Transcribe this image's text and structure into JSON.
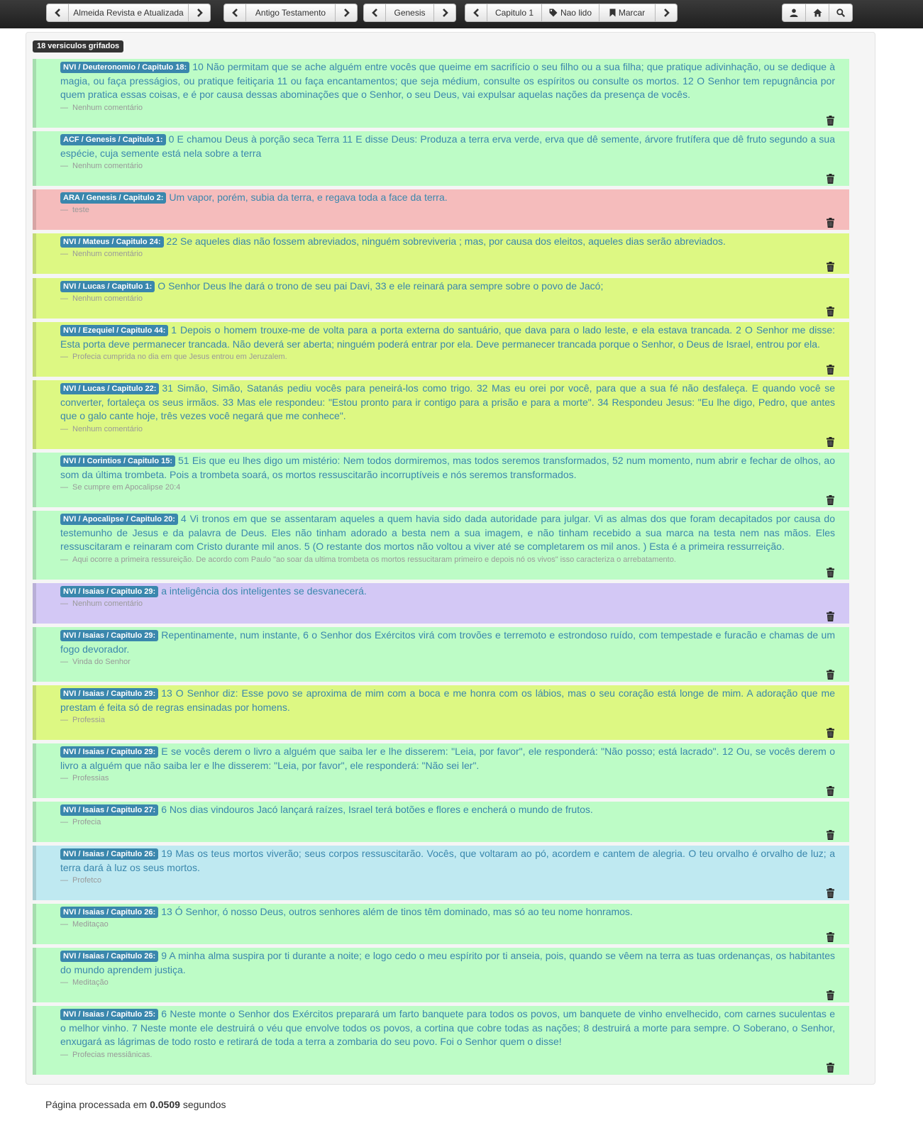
{
  "nav": {
    "version": "Almeida Revista e Atualizada",
    "testament": "Antigo Testamento",
    "book": "Genesis",
    "chapter": "Capitulo 1",
    "unread": "Nao lido",
    "mark": "Marcar"
  },
  "badge": "18 versiculos grifados",
  "colors": {
    "green": "#bdfcc6",
    "red": "#f5bcbc",
    "yellow": "#ddf883",
    "purple": "#d3c8f5",
    "blue": "#bfe9f1",
    "reference_badge": "#3a87ad",
    "verse_text": "#3a87ad"
  },
  "entries": [
    {
      "color": "green",
      "ref": "NVI / Deuteronomio / Capitulo 18:",
      "text": "10 Não permitam que se ache alguém entre vocês que queime em sacrifício o seu filho ou a sua filha; que pratique adivinhação, ou se dedique à magia, ou faça presságios, ou pratique feitiçaria 11 ou faça encantamentos; que seja médium, consulte os espíritos ou consulte os mortos. 12 O Senhor tem repugnância por quem pratica essas coisas, e é por causa dessas abominações que o Senhor, o seu Deus, vai expulsar aquelas nações da presença de vocês.",
      "comment": "Nenhum comentário"
    },
    {
      "color": "green",
      "ref": "ACF / Genesis / Capitulo 1:",
      "text": "0 E chamou Deus à porção seca Terra 11 E disse Deus: Produza a terra erva verde, erva que dê semente, árvore frutífera que dê fruto segundo a sua espécie, cuja semente está nela sobre a terra",
      "comment": "Nenhum comentário"
    },
    {
      "color": "red",
      "ref": "ARA / Genesis / Capitulo 2:",
      "text": "Um vapor, porém, subia da terra, e regava toda a face da terra.",
      "comment": "teste"
    },
    {
      "color": "yellow",
      "ref": "NVI / Mateus / Capitulo 24:",
      "text": "22 Se aqueles dias não fossem abreviados, ninguém sobreviveria ; mas, por causa dos eleitos, aqueles dias serão abreviados.",
      "comment": "Nenhum comentário"
    },
    {
      "color": "yellow",
      "ref": "NVI / Lucas / Capitulo 1:",
      "text": "O Senhor Deus lhe dará o trono de seu pai Davi, 33 e ele reinará para sempre sobre o povo de Jacó;",
      "comment": "Nenhum comentário"
    },
    {
      "color": "yellow",
      "ref": "NVI / Ezequiel / Capitulo 44:",
      "text": "1 Depois o homem trouxe-me de volta para a porta externa do santuário, que dava para o lado leste, e ela estava trancada. 2 O Senhor me disse: Esta porta deve permanecer trancada. Não deverá ser aberta; ninguém poderá entrar por ela. Deve permanecer trancada porque o Senhor, o Deus de Israel, entrou por ela.",
      "comment": "Profecia cumprida no dia em que Jesus entrou em Jeruzalem."
    },
    {
      "color": "yellow",
      "ref": "NVI / Lucas / Capitulo 22:",
      "text": "31 Simão, Simão, Satanás pediu vocês para peneirá-los como trigo. 32 Mas eu orei por você, para que a sua fé não desfaleça. E quando você se converter, fortaleça os seus irmãos. 33 Mas ele respondeu: \"Estou pronto para ir contigo para a prisão e para a morte\". 34 Respondeu Jesus: \"Eu lhe digo, Pedro, que antes que o galo cante hoje, três vezes você negará que me conhece\".",
      "comment": "Nenhum comentário"
    },
    {
      "color": "green",
      "ref": "NVI / I Corintios / Capitulo 15:",
      "text": "51 Eis que eu lhes digo um mistério: Nem todos dormiremos, mas todos seremos transformados, 52 num momento, num abrir e fechar de olhos, ao som da última trombeta. Pois a trombeta soará, os mortos ressuscitarão incorruptíveis e nós seremos transformados.",
      "comment": "Se cumpre em Apocalipse 20:4"
    },
    {
      "color": "green",
      "ref": "NVI / Apocalipse / Capitulo 20:",
      "text": "4 Vi tronos em que se assentaram aqueles a quem havia sido dada autoridade para julgar. Vi as almas dos que foram decapitados por causa do testemunho de Jesus e da palavra de Deus. Eles não tinham adorado a besta nem a sua imagem, e não tinham recebido a sua marca na testa nem nas mãos. Eles ressuscitaram e reinaram com Cristo durante mil anos. 5 (O restante dos mortos não voltou a viver até se completarem os mil anos. ) Esta é a primeira ressurreição.",
      "comment": "Aqui ocorre a primeira ressureição. De acordo com Paulo \"ao soar da ultima trombeta os mortos ressucitaram primeiro e depois nó os vivos\" isso caracteriza o arrebatamento."
    },
    {
      "color": "purple",
      "ref": "NVI / Isaias / Capitulo 29:",
      "text": "a inteligência dos inteligentes se desvanecerá.",
      "comment": "Nenhum comentário"
    },
    {
      "color": "green",
      "ref": "NVI / Isaias / Capitulo 29:",
      "text": "Repentinamente, num instante, 6 o Senhor dos Exércitos virá com trovões e terremoto e estrondoso ruído, com tempestade e furacão e chamas de um fogo devorador.",
      "comment": "Vinda do Senhor"
    },
    {
      "color": "yellow",
      "ref": "NVI / Isaias / Capitulo 29:",
      "text": "13 O Senhor diz: Esse povo se aproxima de mim com a boca e me honra com os lábios, mas o seu coração está longe de mim. A adoração que me prestam é feita só de regras ensinadas por homens.",
      "comment": "Professia"
    },
    {
      "color": "green",
      "ref": "NVI / Isaias / Capitulo 29:",
      "text": "E se vocês derem o livro a alguém que saiba ler e lhe disserem: \"Leia, por favor\", ele responderá: \"Não posso; está lacrado\". 12 Ou, se vocês derem o livro a alguém que não saiba ler e lhe disserem: \"Leia, por favor\", ele responderá: \"Não sei ler\".",
      "comment": "Professias"
    },
    {
      "color": "green",
      "ref": "NVI / Isaias / Capitulo 27:",
      "text": "6 Nos dias vindouros Jacó lançará raízes, Israel terá botões e flores e encherá o mundo de frutos.",
      "comment": "Profecia"
    },
    {
      "color": "blue",
      "ref": "NVI / Isaias / Capitulo 26:",
      "text": "19 Mas os teus mortos viverão; seus corpos ressuscitarão. Vocês, que voltaram ao pó, acordem e cantem de alegria. O teu orvalho é orvalho de luz; a terra dará à luz os seus mortos.",
      "comment": "Profetco"
    },
    {
      "color": "green",
      "ref": "NVI / Isaias / Capitulo 26:",
      "text": "13 Ó Senhor, ó nosso Deus, outros senhores além de tinos têm dominado, mas só ao teu nome honramos.",
      "comment": "Meditaçao"
    },
    {
      "color": "green",
      "ref": "NVI / Isaias / Capitulo 26:",
      "text": "9 A minha alma suspira por ti durante a noite; e logo cedo o meu espírito por ti anseia, pois, quando se vêem na terra as tuas ordenanças, os habitantes do mundo aprendem justiça.",
      "comment": "Meditação"
    },
    {
      "color": "green",
      "ref": "NVI / Isaias / Capitulo 25:",
      "text": "6 Neste monte o Senhor dos Exércitos preparará um farto banquete para todos os povos, um banquete de vinho envelhecido, com carnes suculentas e o melhor vinho. 7 Neste monte ele destruirá o véu que envolve todos os povos, a cortina que cobre todas as nações; 8 destruirá a morte para sempre. O Soberano, o Senhor, enxugará as lágrimas de todo rosto e retirará de toda a terra a zombaria do seu povo. Foi o Senhor quem o disse!",
      "comment": "Profecias messiânicas."
    }
  ],
  "footer": {
    "prefix": "Página processada em",
    "time": "0.0509",
    "suffix": "segundos"
  }
}
